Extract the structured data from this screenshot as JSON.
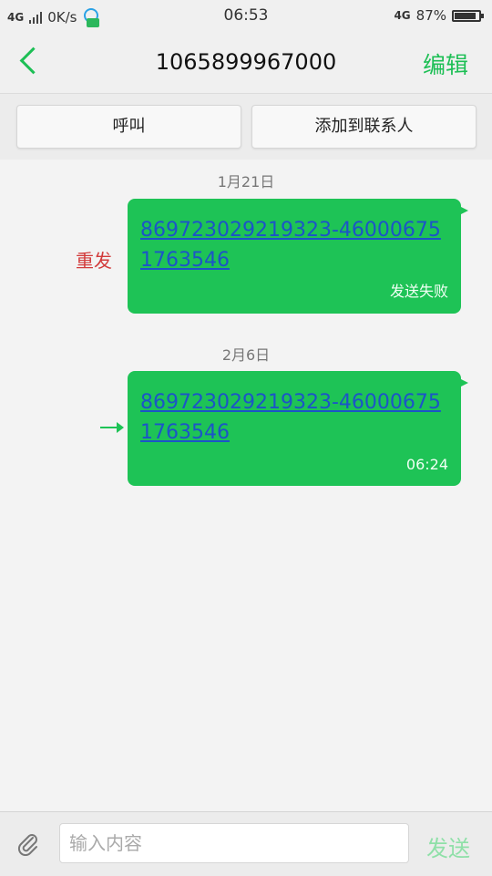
{
  "status": {
    "network_left": "4G",
    "speed": "0K/s",
    "time": "06:53",
    "network_right": "4G",
    "battery": "87%"
  },
  "header": {
    "title": "1065899967000",
    "edit_label": "编辑"
  },
  "actions": {
    "call_label": "呼叫",
    "add_contact_label": "添加到联系人"
  },
  "messages": [
    {
      "date": "1月21日",
      "text": "869723029219323-460006751763546",
      "meta": "发送失败",
      "resend_label": "重发"
    },
    {
      "date": "2月6日",
      "text": "869723029219323-460006751763546",
      "meta": "06:24"
    }
  ],
  "input": {
    "placeholder": "输入内容",
    "send_label": "发送"
  },
  "colors": {
    "accent": "#1dbf55",
    "bubble": "#1ec356",
    "link": "#1c54c8",
    "error": "#d23b3b"
  }
}
